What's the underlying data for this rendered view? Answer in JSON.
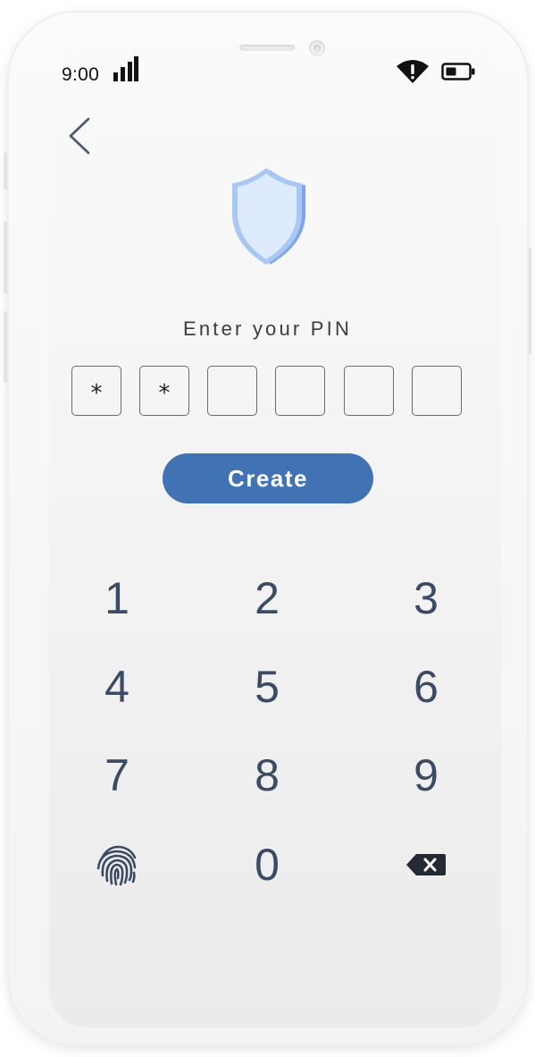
{
  "status_bar": {
    "time": "9:00",
    "icons": [
      "signal-icon",
      "wifi-alert-icon",
      "battery-icon"
    ]
  },
  "header": {
    "back_icon": "chevron-left-icon",
    "shield_icon": "shield-icon"
  },
  "pin": {
    "prompt": "Enter your PIN",
    "digits": [
      "*",
      "*",
      "",
      "",
      "",
      ""
    ]
  },
  "create_button": {
    "label": "Create"
  },
  "keypad": {
    "keys": [
      "1",
      "2",
      "3",
      "4",
      "5",
      "6",
      "7",
      "8",
      "9",
      "0"
    ],
    "left_action_icon": "fingerprint-icon",
    "right_action_icon": "backspace-icon"
  },
  "colors": {
    "accent": "#4173b4",
    "key_text": "#3b4b63",
    "shield_fill": "#dde9fb",
    "shield_edge": "#8fb4ec"
  }
}
